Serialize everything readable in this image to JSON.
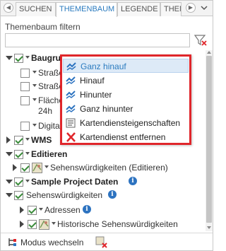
{
  "tabs": {
    "left_arrow": "◀",
    "right_arrow": "▶",
    "items": [
      {
        "label": "SUCHEN",
        "active": false
      },
      {
        "label": "THEMENBAUM",
        "active": true
      },
      {
        "label": "LEGENDE",
        "active": false
      },
      {
        "label": "THEM",
        "active": false
      }
    ]
  },
  "filter": {
    "label": "Themenbaum filtern",
    "value": ""
  },
  "tree": {
    "baugrund": {
      "label": "Baugrund...G...",
      "checked": true
    },
    "strasse1": {
      "label": "Straße",
      "checked": false
    },
    "strasse2": {
      "label": "Straße",
      "checked": false
    },
    "flaeche": {
      "label": "Fläche",
      "label2": "24h",
      "checked": false
    },
    "digital": {
      "label": "Digital",
      "checked": false
    },
    "wms": {
      "label": "WMS",
      "checked": true
    },
    "editieren": {
      "label": "Editieren",
      "checked": true
    },
    "sehens_edit": {
      "label": "Sehenswürdigkeiten (Editieren)",
      "checked": true
    },
    "sample": {
      "label": "Sample Project Daten",
      "checked": true,
      "info": "i"
    },
    "sehens": {
      "label": "Sehenswürdigkeiten",
      "checked": true,
      "info": "i"
    },
    "adressen": {
      "label": "Adressen",
      "checked": true,
      "info": "i"
    },
    "historische": {
      "label": "Historische Sehenswürdigkeiten",
      "checked": true
    }
  },
  "context_menu": {
    "items": [
      {
        "label": "Ganz hinauf",
        "icon": "move-top-icon",
        "highlighted": true
      },
      {
        "label": "Hinauf",
        "icon": "move-up-icon",
        "highlighted": false
      },
      {
        "label": "Hinunter",
        "icon": "move-down-icon",
        "highlighted": false
      },
      {
        "label": "Ganz hinunter",
        "icon": "move-bottom-icon",
        "highlighted": false
      },
      {
        "label": "Kartendiensteigenschaften",
        "icon": "service-properties-icon",
        "highlighted": false
      },
      {
        "label": "Kartendienst entfernen",
        "icon": "remove-x-icon",
        "highlighted": false
      }
    ]
  },
  "bottom": {
    "mode_label": "Modus wechseln"
  },
  "colors": {
    "accent": "#2b7bbf",
    "highlight_border": "#e0262b",
    "check": "#3a8b3a",
    "info": "#2d73c0"
  }
}
